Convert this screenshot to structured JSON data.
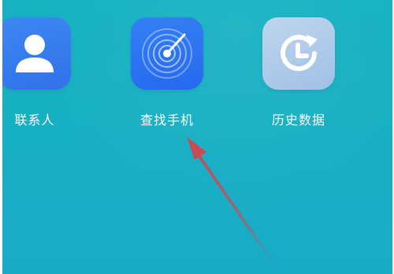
{
  "apps": {
    "contacts": {
      "label": "联系人",
      "icon": "person-icon"
    },
    "find_phone": {
      "label": "查找手机",
      "icon": "radar-icon"
    },
    "history": {
      "label": "历史数据",
      "icon": "clock-restore-icon"
    }
  },
  "annotation": {
    "type": "arrow",
    "points_to": "查找手机",
    "color": "#c94a55"
  },
  "colors": {
    "background": "#17b0c3",
    "contacts_tile": "#3a80f0",
    "find_tile": "#2a73f2",
    "history_tile": "#b4cdea"
  }
}
